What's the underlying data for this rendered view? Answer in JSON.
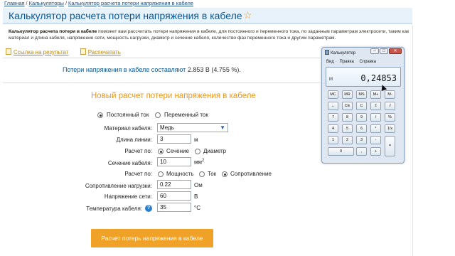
{
  "breadcrumb": [
    "Главная",
    "Калькуляторы",
    "Калькулятор расчета потери напряжения в кабеле"
  ],
  "title": "Калькулятор расчета потери напряжения в кабеле",
  "description": {
    "bold": "Калькулятор расчета потери в кабеле",
    "text": "поможет вам рассчитать потери напряжения в кабеле, для постоянного и переменного тока, по заданным параметрам электросети, таким как материал и длина кабеля, напряжение сети, мощность нагрузки, диаметр и сечение кабеля, количество фаз переменного тока и другим параметрам."
  },
  "links": {
    "link_to_result": "Ссылка на результат",
    "print": "Распечатать"
  },
  "result": {
    "label": "Потери напряжения в кабеле составляют",
    "value": "2.853 В (4.755 %)."
  },
  "form": {
    "title": "Новый расчет потери напряжения в кабеле",
    "current_dc": "Постоянный ток",
    "current_ac": "Переменный ток",
    "current_selected": "dc",
    "material_label": "Материал кабеля:",
    "material_value": "Медь",
    "length_label": "Длина линии:",
    "length_value": "3",
    "length_unit": "м",
    "calc_by_label": "Расчет по:",
    "calc_by_section": "Сечение",
    "calc_by_diameter": "Диаметр",
    "calc_by_selected": "section",
    "section_label": "Сечение кабеля:",
    "section_value": "10",
    "section_unit": "мм",
    "section_unit_sup": "2",
    "calc_by2_label": "Расчет по:",
    "calc_by2_power": "Мощность",
    "calc_by2_current": "Ток",
    "calc_by2_resistance": "Сопротивление",
    "calc_by2_selected": "resistance",
    "load_resistance_label": "Сопротивление нагрузки:",
    "load_resistance_value": "0.22",
    "load_resistance_unit": "Ом",
    "voltage_label": "Напряжение сети:",
    "voltage_value": "60",
    "voltage_unit": "В",
    "temperature_label": "Температура кабеля:",
    "temperature_value": "35",
    "temperature_unit": "°C",
    "help_icon": "question-icon",
    "submit_label": "Расчет потерь напряжения в кабеле"
  },
  "calculator": {
    "title": "Калькулятор",
    "menu": [
      "Вид",
      "Правка",
      "Справка"
    ],
    "memory_indicator": "M",
    "display": "0,24853",
    "keys": [
      [
        "MC",
        "MR",
        "MS",
        "M+",
        "M-"
      ],
      [
        "←",
        "CE",
        "C",
        "±",
        "√"
      ],
      [
        "7",
        "8",
        "9",
        "/",
        "%"
      ],
      [
        "4",
        "5",
        "6",
        "*",
        "1/x"
      ],
      [
        "1",
        "2",
        "3",
        "-",
        "="
      ],
      [
        "0",
        ",",
        "+"
      ]
    ]
  },
  "colors": {
    "title_text": "#0a5590",
    "accent_orange": "#f0a127",
    "link_gold": "#b8860b",
    "star": "#e9a32a"
  }
}
